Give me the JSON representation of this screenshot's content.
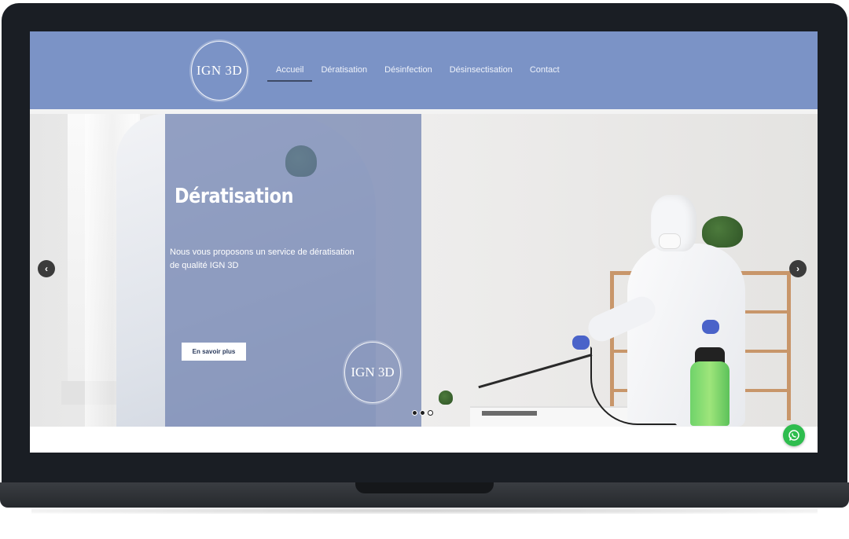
{
  "header": {
    "logo_text": "IGN 3D",
    "nav": [
      {
        "label": "Accueil",
        "active": true
      },
      {
        "label": "Dératisation",
        "active": false
      },
      {
        "label": "Désinfection",
        "active": false
      },
      {
        "label": "Désinsectisation",
        "active": false
      },
      {
        "label": "Contact",
        "active": false
      }
    ]
  },
  "hero": {
    "title": "Dératisation",
    "description": "Nous vous proposons un service de dératisation de qualité IGN 3D",
    "cta_label": "En savoir plus",
    "overlay_logo_text": "IGN 3D",
    "prev_icon": "chevron-left-icon",
    "next_icon": "chevron-right-icon",
    "slides_count": 3,
    "active_slide": 3
  },
  "floating": {
    "whatsapp_icon": "whatsapp-icon",
    "whatsapp_color": "#2ebd4e"
  },
  "colors": {
    "header_bg": "#7b93c6",
    "overlay_bg": "#6e7fae",
    "frame": "#1a1e24"
  }
}
